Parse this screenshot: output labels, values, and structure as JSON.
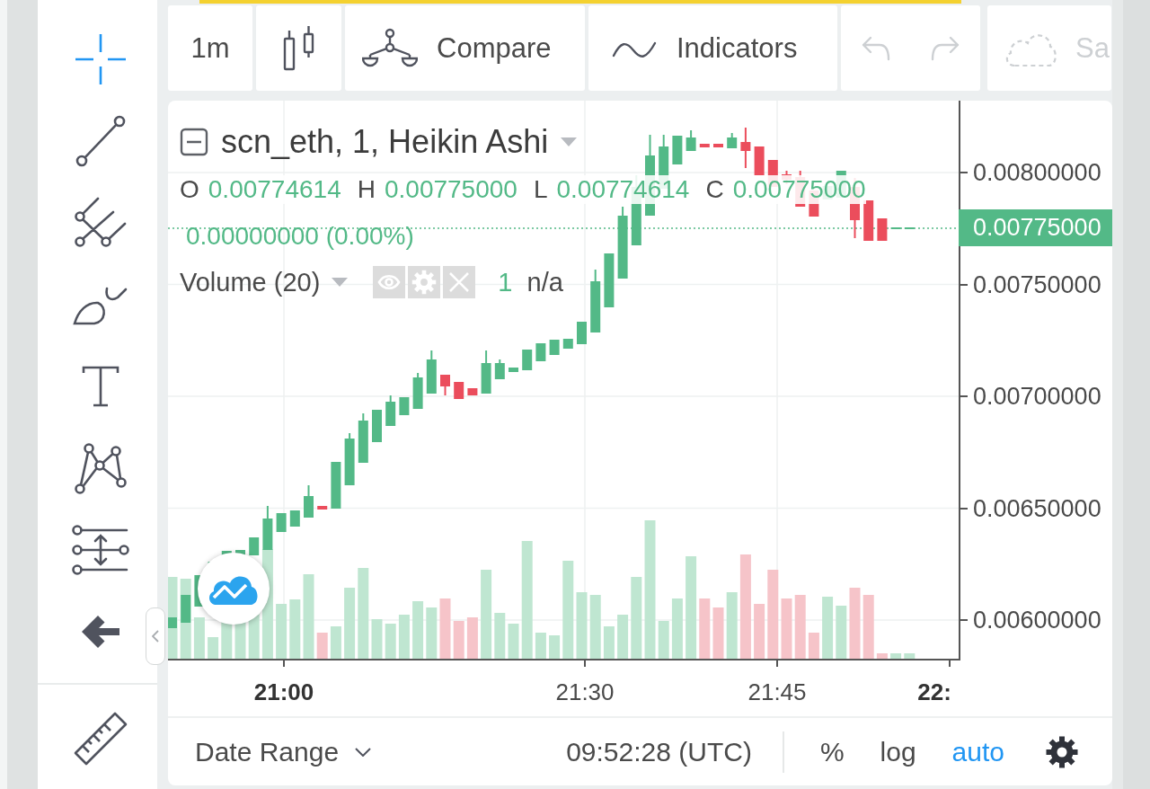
{
  "drawing_tools": [
    {
      "kind": "crosshair",
      "selected": true
    },
    {
      "kind": "trend-line",
      "selected": false
    },
    {
      "kind": "pitchfork",
      "selected": false
    },
    {
      "kind": "brush",
      "selected": false
    },
    {
      "kind": "text",
      "selected": false
    },
    {
      "kind": "pattern",
      "selected": false
    },
    {
      "kind": "levels",
      "selected": false
    },
    {
      "kind": "arrow",
      "selected": false
    }
  ],
  "measure_tool": {
    "kind": "ruler",
    "selected": false
  },
  "toolbar": {
    "interval": "1m",
    "compare": "Compare",
    "indicators": "Indicators",
    "undo": {
      "disabled": true
    },
    "redo": {
      "disabled": true
    },
    "save": {
      "label": "Sa",
      "disabled": true
    }
  },
  "legend": {
    "title": "scn_eth, 1, Heikin Ashi",
    "ohlc": [
      {
        "label": "O",
        "value": "0.00774614"
      },
      {
        "label": "H",
        "value": "0.00775000"
      },
      {
        "label": "L",
        "value": "0.00774614"
      },
      {
        "label": "C",
        "value": "0.00775000"
      }
    ],
    "change": "0.00000000 (0.00%)",
    "volume": {
      "name": "Volume (20)",
      "value": "1",
      "extra": "n/a"
    }
  },
  "price_axis": {
    "labels": [
      "0.00800000",
      "0.00750000",
      "0.00700000",
      "0.00650000",
      "0.00600000"
    ],
    "last_price": "0.00775000"
  },
  "time_axis": [
    {
      "label": "21:00",
      "major": true
    },
    {
      "label": "21:30",
      "major": false
    },
    {
      "label": "21:45",
      "major": false
    },
    {
      "label": "22:",
      "major": true
    }
  ],
  "bottom_bar": {
    "date_range": "Date Range",
    "clock": "09:52:28 (UTC)",
    "scale_modes": [
      {
        "label": "%",
        "selected": false
      },
      {
        "label": "log",
        "selected": false
      },
      {
        "label": "auto",
        "selected": true
      }
    ]
  }
}
